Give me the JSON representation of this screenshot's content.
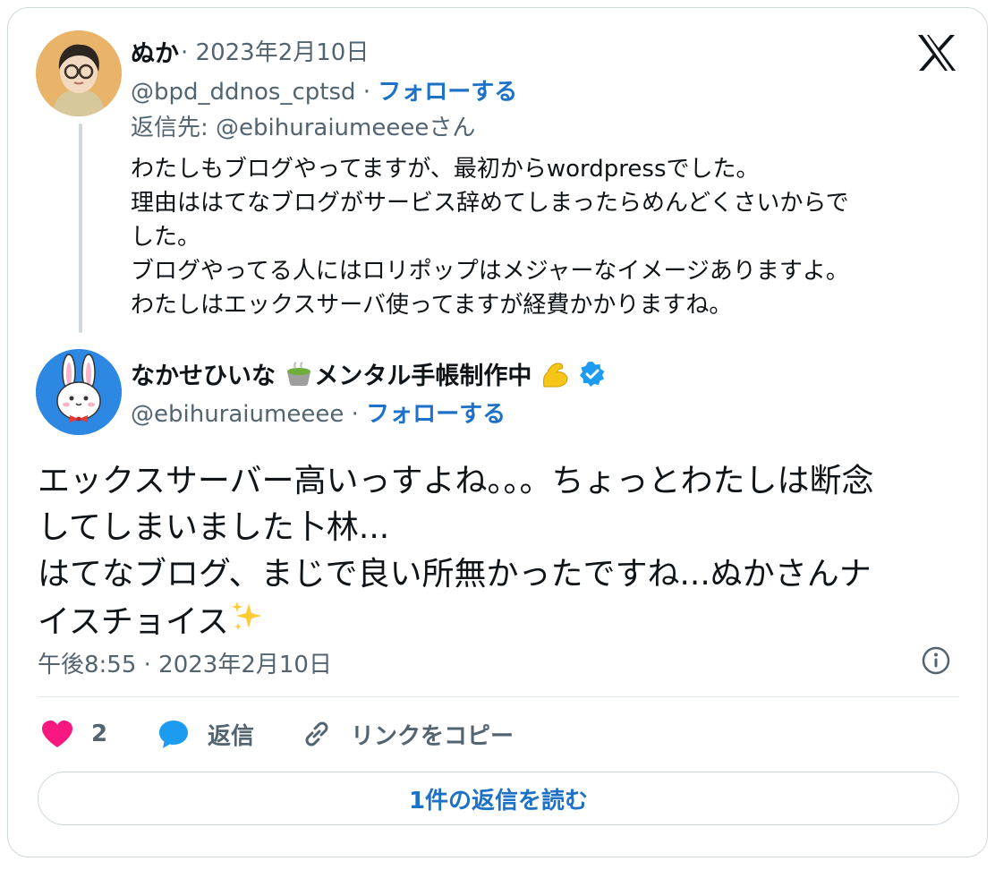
{
  "embed": {
    "logo_icon": "x-logo-icon"
  },
  "parent_tweet": {
    "author_name": "ぬか",
    "date_sep": " · ",
    "date": "2023年2月10日",
    "handle": "@bpd_ddnos_cptsd",
    "follow_sep": " · ",
    "follow_label": "フォローする",
    "reply_to_prefix": "返信先: ",
    "reply_to_handle": "@ebihuraiumeeee",
    "reply_to_suffix": "さん",
    "lines": [
      "わたしもブログやってますが、最初からwordpressでした。",
      "理由ははてなブログがサービス辞めてしまったらめんどくさいからで",
      "した。",
      "ブログやってる人にはロリポップはメジャーなイメージありますよ。",
      "わたしはエックスサーバ使ってますが経費かかりますね。"
    ]
  },
  "main_tweet": {
    "author_name": "なかせひいな",
    "author_name_rest": "メンタル手帳制作中",
    "name_emoji_1": "matcha-tea-emoji",
    "name_emoji_2": "flexed-biceps-emoji",
    "verified_icon": "verified-badge-icon",
    "handle": "@ebihuraiumeeee",
    "follow_sep": " · ",
    "follow_label": "フォローする",
    "lines": [
      "エックスサーバー高いっすよね。。。ちょっとわたしは断念",
      "してしまいました卜林...",
      "はてなブログ、まじで良い所無かったですね...ぬかさんナ",
      "イスチョイス"
    ],
    "end_emoji": "sparkles-emoji",
    "timestamp": "午後8:55 · 2023年2月10日",
    "info_icon": "info-icon"
  },
  "actions": {
    "like_count": "2",
    "reply_label": "返信",
    "copy_link_label": "リンクをコピー"
  },
  "read_replies_label": "1件の返信を読む",
  "colors": {
    "accent": "#1d72c8",
    "verified": "#1d9bf0",
    "heart": "#f91880",
    "reply": "#1d9bf0",
    "muted": "#536471",
    "border": "#cfd9de"
  }
}
